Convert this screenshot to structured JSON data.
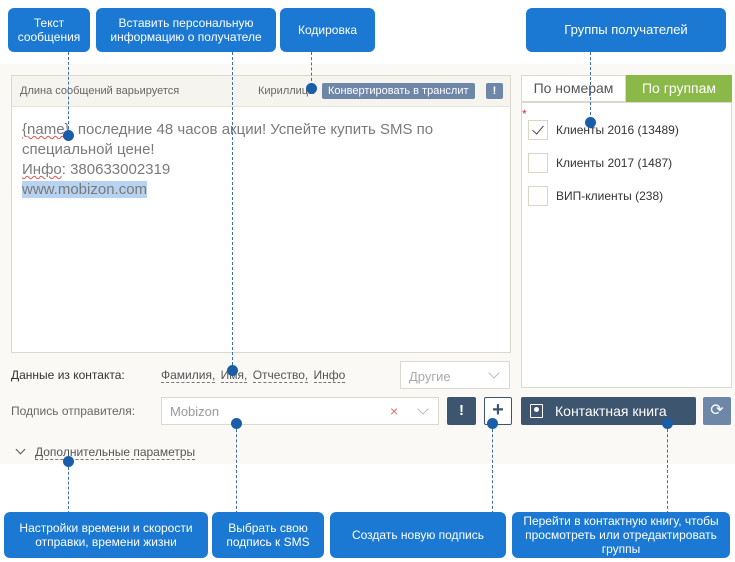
{
  "callouts": {
    "message_text": "Текст сообщения",
    "personal_info": "Вставить персональную информацию о получателе",
    "encoding": "Кодировка",
    "recipient_groups": "Группы получателей",
    "time_settings": "Настройки времени и скорости отправки, времени жизни",
    "choose_signature": "Выбрать свою подпись к SMS",
    "create_signature": "Создать новую подпись",
    "contact_book": "Перейти в контактную книгу, чтобы просмотреть или отредактировать группы"
  },
  "message": {
    "length_label": "Длина сообщений варьируется",
    "encoding_label": "Кириллица",
    "translit_button": "Конвертировать в транслит",
    "warn_button": "!",
    "text_line1_prefix": "{name}",
    "text_line1_rest": ", последние 48 часов акции! Успейте купить SMS по специальной цене!",
    "text_line2_label": "Инфо",
    "text_line2_rest": ": 380633002319",
    "text_line3": "www.mobizon.com"
  },
  "groups": {
    "tab_numbers": "По номерам",
    "tab_groups": "По группам",
    "required_mark": "*",
    "items": [
      {
        "label": "Клиенты 2016 (13489)",
        "checked": true
      },
      {
        "label": "Клиенты 2017 (1487)",
        "checked": false
      },
      {
        "label": "ВИП-клиенты (238)",
        "checked": false
      }
    ]
  },
  "contact_data": {
    "label": "Данные из контакта:",
    "fields": [
      "Фамилия,",
      "Имя,",
      "Отчество,",
      "Инфо"
    ],
    "other_placeholder": "Другие"
  },
  "signature": {
    "label": "Подпись отправителя:",
    "value": "Mobizon",
    "clear": "×",
    "warn_button": "!",
    "add_button": "+"
  },
  "contact_book_button": "Контактная книга",
  "refresh_button": "⟳",
  "advanced_params": "Дополнительные параметры"
}
